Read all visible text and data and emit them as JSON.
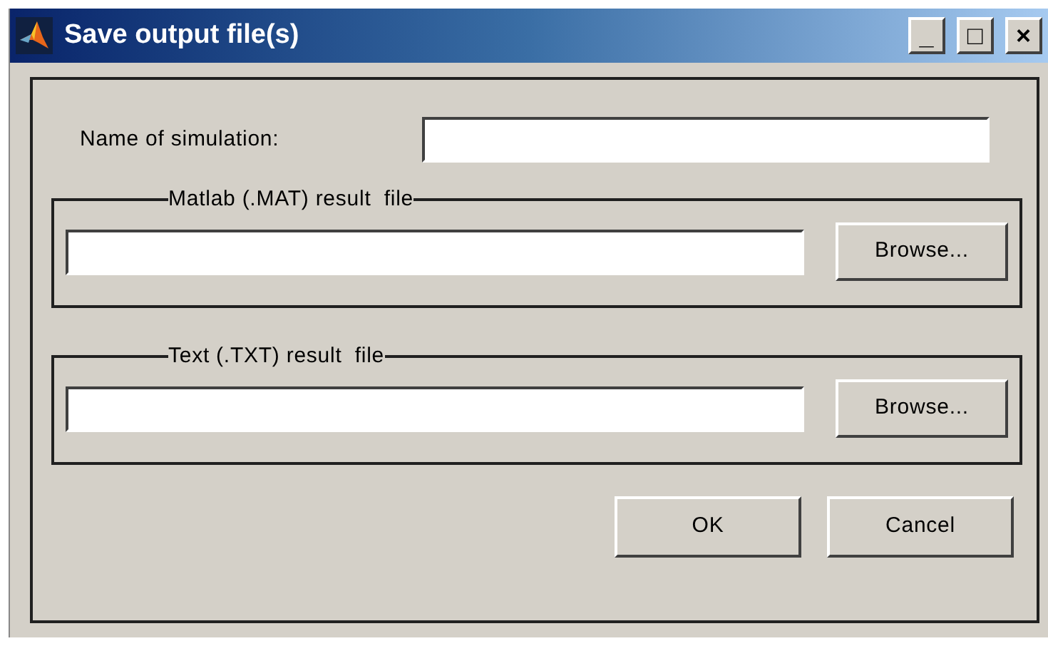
{
  "window": {
    "title": "Save output file(s)",
    "controls": [
      "_",
      "□",
      "×"
    ]
  },
  "simulation": {
    "label": "Name of simulation:"
  },
  "groups": [
    {
      "title": "Matlab (.MAT) result  file",
      "button": "Browse..."
    },
    {
      "title": "Text (.TXT) result  file",
      "button": "Browse..."
    }
  ],
  "buttons": [
    "OK",
    "Cancel"
  ]
}
